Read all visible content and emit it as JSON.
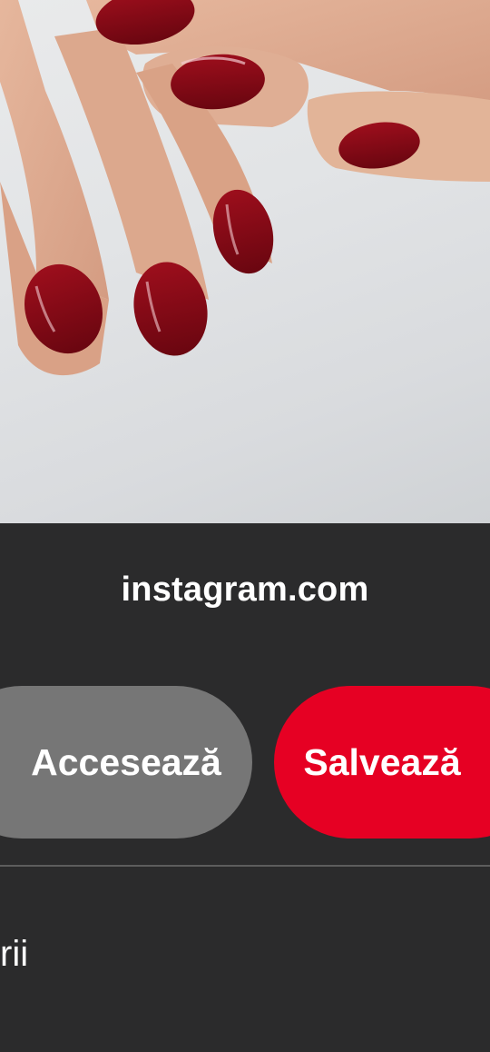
{
  "pin": {
    "image_alt": "dark red manicured nails",
    "source_domain": "instagram.com"
  },
  "actions": {
    "visit_label": "Accesează",
    "save_label": "Salvează"
  },
  "section": {
    "partial_label": "rii"
  },
  "colors": {
    "background": "#2b2b2c",
    "visit_button": "#767676",
    "save_button": "#e60023",
    "text": "#ffffff",
    "divider": "#5d5d5d"
  }
}
